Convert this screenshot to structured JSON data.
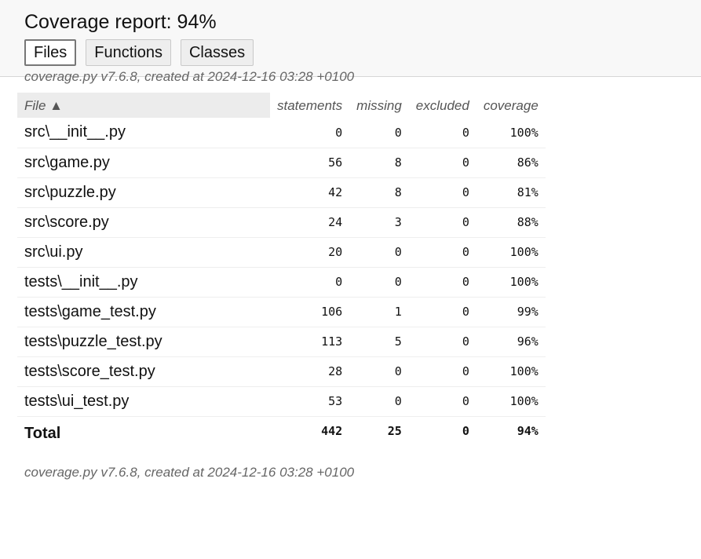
{
  "header": {
    "title": "Coverage report: 94%",
    "tabs": [
      {
        "label": "Files",
        "active": true
      },
      {
        "label": "Functions",
        "active": false
      },
      {
        "label": "Classes",
        "active": false
      }
    ],
    "meta": "coverage.py v7.6.8, created at 2024-12-16 03:28 +0100"
  },
  "table": {
    "columns": [
      "File ▲",
      "statements",
      "missing",
      "excluded",
      "coverage"
    ],
    "rows": [
      {
        "file": "src\\__init__.py",
        "statements": "0",
        "missing": "0",
        "excluded": "0",
        "coverage": "100%"
      },
      {
        "file": "src\\game.py",
        "statements": "56",
        "missing": "8",
        "excluded": "0",
        "coverage": "86%"
      },
      {
        "file": "src\\puzzle.py",
        "statements": "42",
        "missing": "8",
        "excluded": "0",
        "coverage": "81%"
      },
      {
        "file": "src\\score.py",
        "statements": "24",
        "missing": "3",
        "excluded": "0",
        "coverage": "88%"
      },
      {
        "file": "src\\ui.py",
        "statements": "20",
        "missing": "0",
        "excluded": "0",
        "coverage": "100%"
      },
      {
        "file": "tests\\__init__.py",
        "statements": "0",
        "missing": "0",
        "excluded": "0",
        "coverage": "100%"
      },
      {
        "file": "tests\\game_test.py",
        "statements": "106",
        "missing": "1",
        "excluded": "0",
        "coverage": "99%"
      },
      {
        "file": "tests\\puzzle_test.py",
        "statements": "113",
        "missing": "5",
        "excluded": "0",
        "coverage": "96%"
      },
      {
        "file": "tests\\score_test.py",
        "statements": "28",
        "missing": "0",
        "excluded": "0",
        "coverage": "100%"
      },
      {
        "file": "tests\\ui_test.py",
        "statements": "53",
        "missing": "0",
        "excluded": "0",
        "coverage": "100%"
      }
    ],
    "total": {
      "label": "Total",
      "statements": "442",
      "missing": "25",
      "excluded": "0",
      "coverage": "94%"
    }
  },
  "footer": {
    "meta": "coverage.py v7.6.8, created at 2024-12-16 03:28 +0100"
  }
}
